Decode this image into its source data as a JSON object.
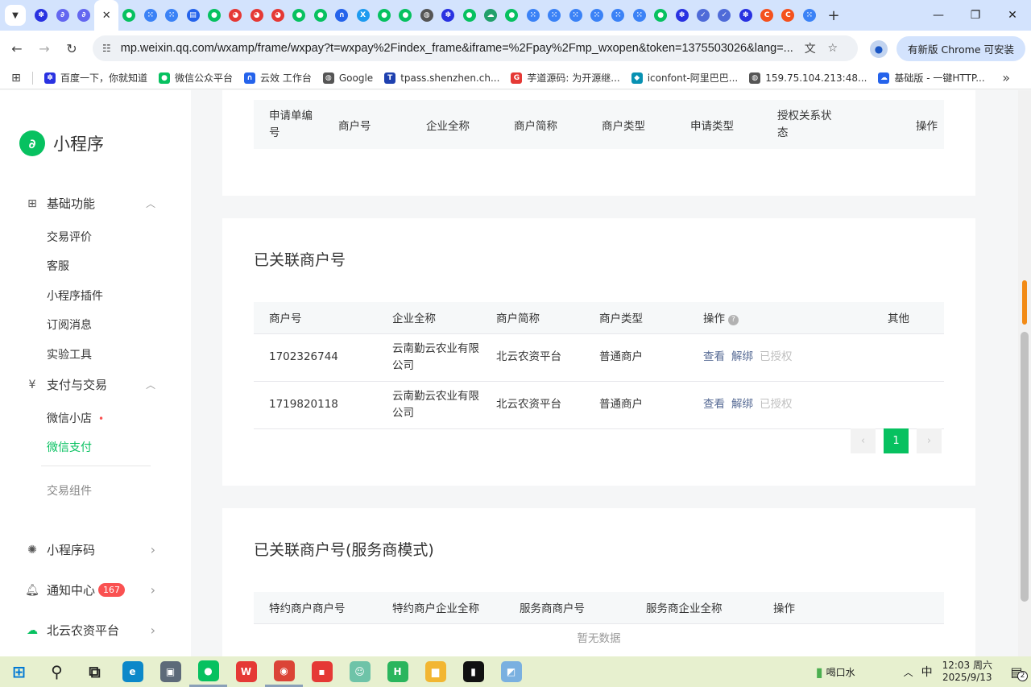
{
  "browser": {
    "tabs": [
      {
        "icon": "baidu-paw-icon",
        "color": "#2932e1",
        "glyph": "✽"
      },
      {
        "icon": "mini-program-icon",
        "color": "#6467f0",
        "glyph": "∂"
      },
      {
        "icon": "mini-program-icon",
        "color": "#6467f0",
        "glyph": "∂"
      },
      {
        "icon": "close-icon",
        "color": "#333333",
        "glyph": "✕",
        "active": true
      },
      {
        "icon": "wechat-icon",
        "color": "#07c160",
        "glyph": "●"
      },
      {
        "icon": "grid-icon",
        "color": "#3b82f6",
        "glyph": "⁙"
      },
      {
        "icon": "grid-icon",
        "color": "#3b82f6",
        "glyph": "⁙"
      },
      {
        "icon": "doc-icon",
        "color": "#2563eb",
        "glyph": "▤"
      },
      {
        "icon": "wechat-icon",
        "color": "#07c160",
        "glyph": "●"
      },
      {
        "icon": "qq-icon",
        "color": "#e53935",
        "glyph": "◕"
      },
      {
        "icon": "qq-icon",
        "color": "#e53935",
        "glyph": "◕"
      },
      {
        "icon": "qq-icon",
        "color": "#e53935",
        "glyph": "◕"
      },
      {
        "icon": "wechat-pay-icon",
        "color": "#07c160",
        "glyph": "●"
      },
      {
        "icon": "wechat-icon",
        "color": "#07c160",
        "glyph": "●"
      },
      {
        "icon": "cloud-effect-icon",
        "color": "#2563eb",
        "glyph": "∩"
      },
      {
        "icon": "x-icon",
        "color": "#1d9bf0",
        "glyph": "X"
      },
      {
        "icon": "wechat-icon",
        "color": "#07c160",
        "glyph": "●"
      },
      {
        "icon": "wechat-icon",
        "color": "#07c160",
        "glyph": "●"
      },
      {
        "icon": "globe-icon",
        "color": "#555555",
        "glyph": "◍"
      },
      {
        "icon": "baidu-paw-icon",
        "color": "#2932e1",
        "glyph": "✽"
      },
      {
        "icon": "wechat-pay-icon",
        "color": "#07c160",
        "glyph": "●"
      },
      {
        "icon": "cloud-icon",
        "color": "#22a06b",
        "glyph": "☁"
      },
      {
        "icon": "wechat-icon",
        "color": "#07c160",
        "glyph": "●"
      },
      {
        "icon": "grid-icon",
        "color": "#3b82f6",
        "glyph": "⁙"
      },
      {
        "icon": "grid-icon",
        "color": "#3b82f6",
        "glyph": "⁙"
      },
      {
        "icon": "grid-icon",
        "color": "#3b82f6",
        "glyph": "⁙"
      },
      {
        "icon": "grid-icon",
        "color": "#3b82f6",
        "glyph": "⁙"
      },
      {
        "icon": "grid-icon",
        "color": "#3b82f6",
        "glyph": "⁙"
      },
      {
        "icon": "grid-icon",
        "color": "#3b82f6",
        "glyph": "⁙"
      },
      {
        "icon": "wechat-icon",
        "color": "#07c160",
        "glyph": "●"
      },
      {
        "icon": "baidu-paw-icon",
        "color": "#2932e1",
        "glyph": "✽"
      },
      {
        "icon": "bird-icon",
        "color": "#4f6bd8",
        "glyph": "✓"
      },
      {
        "icon": "bird-icon",
        "color": "#4f6bd8",
        "glyph": "✓"
      },
      {
        "icon": "baidu-paw-icon",
        "color": "#2932e1",
        "glyph": "✽"
      },
      {
        "icon": "c-logo-icon",
        "color": "#f4511e",
        "glyph": "C"
      },
      {
        "icon": "c-logo-icon",
        "color": "#f4511e",
        "glyph": "C"
      },
      {
        "icon": "grid-icon",
        "color": "#3b82f6",
        "glyph": "⁙"
      }
    ],
    "new_tab": "+",
    "window_controls": {
      "minimize": "—",
      "restore": "❐",
      "close": "✕"
    },
    "address": "mp.weixin.qq.com/wxamp/frame/wxpay?t=wxpay%2Findex_frame&iframe=%2Fpay%2Fmp_wxopen&token=1375503026&lang=...",
    "update_button": "有新版 Chrome 可安装",
    "bookmarks": [
      {
        "label": "百度一下，你就知道",
        "icon": "baidu-paw-icon",
        "color": "#2932e1",
        "glyph": "✽"
      },
      {
        "label": "微信公众平台",
        "icon": "wechat-icon",
        "color": "#07c160",
        "glyph": "●"
      },
      {
        "label": "云效 工作台",
        "icon": "cloud-effect-icon",
        "color": "#2563eb",
        "glyph": "∩"
      },
      {
        "label": "Google",
        "icon": "globe-icon",
        "color": "#555555",
        "glyph": "◍"
      },
      {
        "label": "tpass.shenzhen.ch...",
        "icon": "tpass-icon",
        "color": "#1e40af",
        "glyph": "T"
      },
      {
        "label": "芋道源码: 为开源继...",
        "icon": "g-logo-icon",
        "color": "#e53935",
        "glyph": "G"
      },
      {
        "label": "iconfont-阿里巴巴...",
        "icon": "iconfont-icon",
        "color": "#0891b2",
        "glyph": "◆"
      },
      {
        "label": "159.75.104.213:48...",
        "icon": "globe-icon",
        "color": "#555555",
        "glyph": "◍"
      },
      {
        "label": "基础版 - 一键HTTP...",
        "icon": "cloud-icon",
        "color": "#2563eb",
        "glyph": "☁"
      }
    ],
    "bookmarks_more": "»"
  },
  "sidebar": {
    "app_name": "小程序",
    "groups": [
      {
        "label": "基础功能",
        "icon": "grid-icon",
        "glyph": "⊞",
        "chevron": "︿"
      },
      {
        "label": "支付与交易",
        "icon": "yen-icon",
        "glyph": "¥",
        "chevron": "︿"
      }
    ],
    "basic_items": [
      "交易评价",
      "客服",
      "小程序插件",
      "订阅消息",
      "实验工具"
    ],
    "pay_items": [
      {
        "label": "微信小店",
        "dot": "•"
      },
      {
        "label": "微信支付",
        "active": true
      }
    ],
    "pay_sub2": "交易组件",
    "bottom": [
      {
        "label": "小程序码",
        "icon": "qrcode-icon",
        "glyph": "✺"
      },
      {
        "label": "通知中心",
        "icon": "bell-icon",
        "glyph": "♫",
        "badge": "167"
      },
      {
        "label": "北云农资平台",
        "icon": "cloud-icon",
        "glyph": "☁"
      }
    ],
    "chevron_right": "›"
  },
  "main": {
    "table1": {
      "headers": [
        "申请单编号",
        "商户号",
        "企业全称",
        "商户简称",
        "商户类型",
        "申请类型",
        "授权关系状态",
        "操作"
      ]
    },
    "linked": {
      "title": "已关联商户号",
      "headers": [
        "商户号",
        "企业全称",
        "商户简称",
        "商户类型",
        "操作",
        "其他"
      ],
      "help_icon": "?",
      "rows": [
        {
          "mch_id": "1702326744",
          "company": "云南勤云农业有限公司",
          "short": "北云农资平台",
          "type": "普通商户",
          "view": "查看",
          "unbind": "解绑",
          "auth": "已授权"
        },
        {
          "mch_id": "1719820118",
          "company": "云南勤云农业有限公司",
          "short": "北云农资平台",
          "type": "普通商户",
          "view": "查看",
          "unbind": "解绑",
          "auth": "已授权"
        }
      ],
      "pager": {
        "prev": "‹",
        "page": "1",
        "next": "›"
      }
    },
    "provider": {
      "title": "已关联商户号(服务商模式)",
      "headers": [
        "特约商户商户号",
        "特约商户企业全称",
        "服务商商户号",
        "服务商企业全称",
        "操作"
      ],
      "empty": "暂无数据"
    }
  },
  "taskbar": {
    "apps": [
      {
        "icon": "windows-start-icon",
        "color": "#0078d4",
        "glyph": "⊞"
      },
      {
        "icon": "search-icon",
        "color": "#222222",
        "glyph": "⚲"
      },
      {
        "icon": "task-view-icon",
        "color": "#222222",
        "glyph": "⧉"
      },
      {
        "icon": "edge-icon",
        "color": "#0c88c9",
        "glyph": "e"
      },
      {
        "icon": "remote-desktop-icon",
        "color": "#5d6a79",
        "glyph": "▣"
      },
      {
        "icon": "wechat-icon",
        "color": "#07c160",
        "glyph": "●",
        "run": true
      },
      {
        "icon": "wps-icon",
        "color": "#e53935",
        "glyph": "W"
      },
      {
        "icon": "chrome-icon",
        "color": "#db4437",
        "glyph": "◉",
        "run": true
      },
      {
        "icon": "red-app-icon",
        "color": "#e53935",
        "glyph": "▪"
      },
      {
        "icon": "chat-bot-icon",
        "color": "#6ec3a8",
        "glyph": "☺"
      },
      {
        "icon": "hbuilder-icon",
        "color": "#2ab55d",
        "glyph": "H"
      },
      {
        "icon": "file-explorer-icon",
        "color": "#f2b632",
        "glyph": "▆"
      },
      {
        "icon": "terminal-icon",
        "color": "#111111",
        "glyph": "▮"
      },
      {
        "icon": "notebook-icon",
        "color": "#7ab0e0",
        "glyph": "◩"
      }
    ],
    "reminder": "喝口水",
    "tray_up": "︿",
    "ime": "中",
    "time": "12:03 周六",
    "date": "2025/9/13",
    "notif_count": "2"
  }
}
